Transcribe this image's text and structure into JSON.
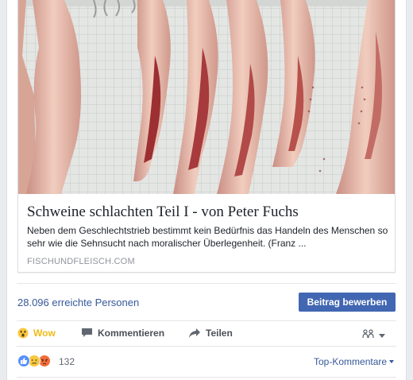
{
  "link_preview": {
    "title": "Schweine schlachten Teil I - von Peter Fuchs",
    "description": "Neben dem Geschlechtstrieb bestimmt kein Bedürfnis das Handeln des Menschen so sehr wie die Sehnsucht nach moralischer Überlegenheit. (Franz ...",
    "domain": "FISCHUNDFLEISCH.COM"
  },
  "insights": {
    "reach_label": "28.096 erreichte Personen",
    "boost_label": "Beitrag bewerben"
  },
  "actions": {
    "wow_label": "Wow",
    "comment_label": "Kommentieren",
    "share_label": "Teilen"
  },
  "reactions": {
    "count": "132",
    "sort_label": "Top-Kommentare",
    "types": [
      "like-icon",
      "sad-icon",
      "angry-icon"
    ]
  },
  "colors": {
    "link_blue": "#365899",
    "button_blue": "#4267b2",
    "wow_yellow": "#f0ba15"
  }
}
